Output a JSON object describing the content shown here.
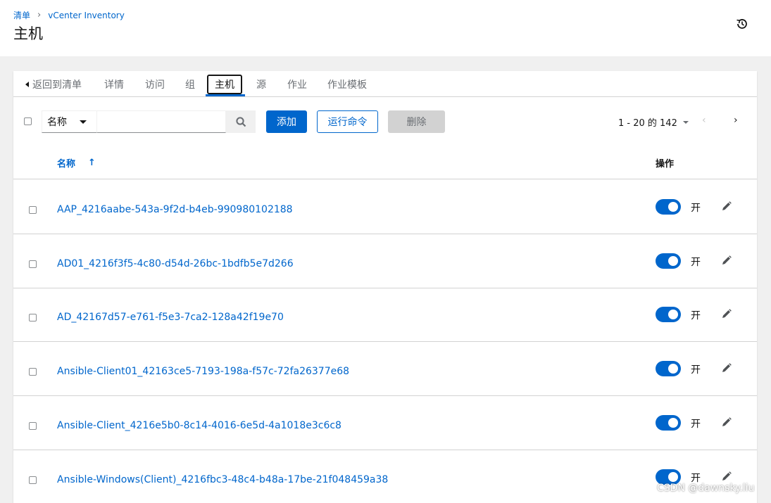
{
  "breadcrumb": {
    "root": "清单",
    "current": "vCenter Inventory"
  },
  "page": {
    "title": "主机"
  },
  "tabs": [
    {
      "label": "返回到清单"
    },
    {
      "label": "详情"
    },
    {
      "label": "访问"
    },
    {
      "label": "组"
    },
    {
      "label": "主机",
      "active": true
    },
    {
      "label": "源"
    },
    {
      "label": "作业"
    },
    {
      "label": "作业模板"
    }
  ],
  "toolbar": {
    "filter_field": "名称",
    "search_placeholder": "",
    "add_label": "添加",
    "run_command_label": "运行命令",
    "delete_label": "删除"
  },
  "pagination": {
    "range": "1 - 20 的 142",
    "prev_icon": "‹",
    "next_icon": "›"
  },
  "table": {
    "col_name": "名称",
    "sort_icon": "↑",
    "col_actions": "操作",
    "rows": [
      {
        "name": "AAP_4216aabe-543a-9f2d-b4eb-990980102188",
        "enabled": true,
        "toggle_label": "开"
      },
      {
        "name": "AD01_4216f3f5-4c80-d54d-26bc-1bdfb5e7d266",
        "enabled": true,
        "toggle_label": "开"
      },
      {
        "name": "AD_42167d57-e761-f5e3-7ca2-128a42f19e70",
        "enabled": true,
        "toggle_label": "开"
      },
      {
        "name": "Ansible-Client01_42163ce5-7193-198a-f57c-72fa26377e68",
        "enabled": true,
        "toggle_label": "开"
      },
      {
        "name": "Ansible-Client_4216e5b0-8c14-4016-6e5d-4a1018e3c6c8",
        "enabled": true,
        "toggle_label": "开"
      },
      {
        "name": "Ansible-Windows(Client)_4216fbc3-48c4-b48a-17be-21f048459a38",
        "enabled": true,
        "toggle_label": "开"
      }
    ]
  },
  "watermark": "CSDN @dawnsky.liu",
  "colors": {
    "accent": "#0066cc",
    "border": "#d2d2d2",
    "page_bg": "#f0f0f0"
  },
  "icons": {
    "history": "history-icon",
    "search": "search-icon",
    "edit": "pencil-icon"
  }
}
